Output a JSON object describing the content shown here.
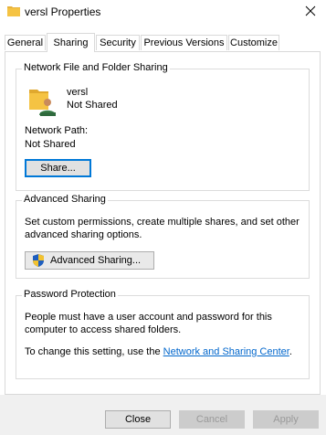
{
  "window": {
    "title": "versl Properties",
    "icon": "folder-icon",
    "close_icon": "close-icon"
  },
  "tabs": [
    {
      "label": "General"
    },
    {
      "label": "Sharing",
      "active": true
    },
    {
      "label": "Security"
    },
    {
      "label": "Previous Versions"
    },
    {
      "label": "Customize"
    }
  ],
  "network_sharing": {
    "group_title": "Network File and Folder Sharing",
    "folder_name": "versl",
    "status": "Not Shared",
    "path_label": "Network Path:",
    "path_value": "Not Shared",
    "share_button": "Share..."
  },
  "advanced_sharing": {
    "group_title": "Advanced Sharing",
    "line1": "Set custom permissions, create multiple shares, and set other",
    "line2": "advanced sharing options.",
    "button": "Advanced Sharing...",
    "button_icon": "shield-icon"
  },
  "password_protection": {
    "group_title": "Password Protection",
    "line1": "People must have a user account and password for this",
    "line2": "computer to access shared folders.",
    "change_prefix": "To change this setting, use the ",
    "link": "Network and Sharing Center",
    "change_suffix": "."
  },
  "footer": {
    "close": "Close",
    "cancel": "Cancel",
    "apply": "Apply"
  },
  "colors": {
    "link": "#0066cc",
    "focus_border": "#0078d7",
    "folder": "#f5c343"
  }
}
